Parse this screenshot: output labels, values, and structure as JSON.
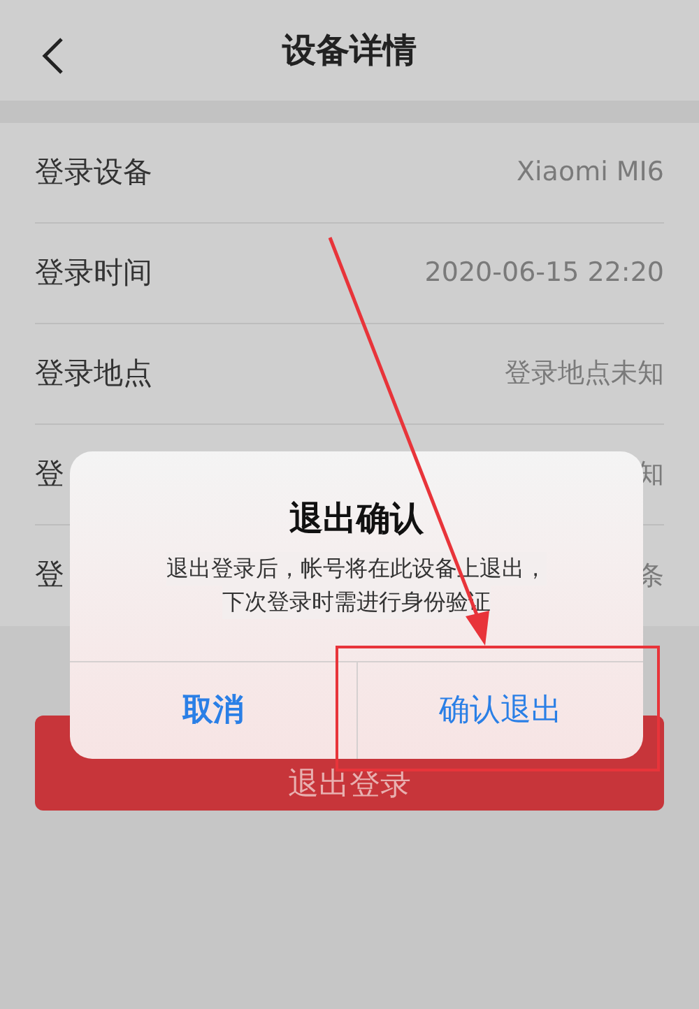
{
  "header": {
    "title": "设备详情"
  },
  "rows": [
    {
      "label": "登录设备",
      "value": "Xiaomi MI6"
    },
    {
      "label": "登录时间",
      "value": "2020-06-15 22:20"
    },
    {
      "label": "登录地点",
      "value": "登录地点未知"
    },
    {
      "label": "登",
      "value": "知"
    },
    {
      "label": "登",
      "value": "条"
    }
  ],
  "logout_button": "退出登录",
  "dialog": {
    "title": "退出确认",
    "message": [
      "退出登录后，帐号将在此设备上退出，",
      "下次登录时需进行身份验证"
    ],
    "buttons": [
      {
        "label": "取消",
        "highlighted": false
      },
      {
        "label": "确认退出",
        "highlighted": true
      }
    ]
  }
}
